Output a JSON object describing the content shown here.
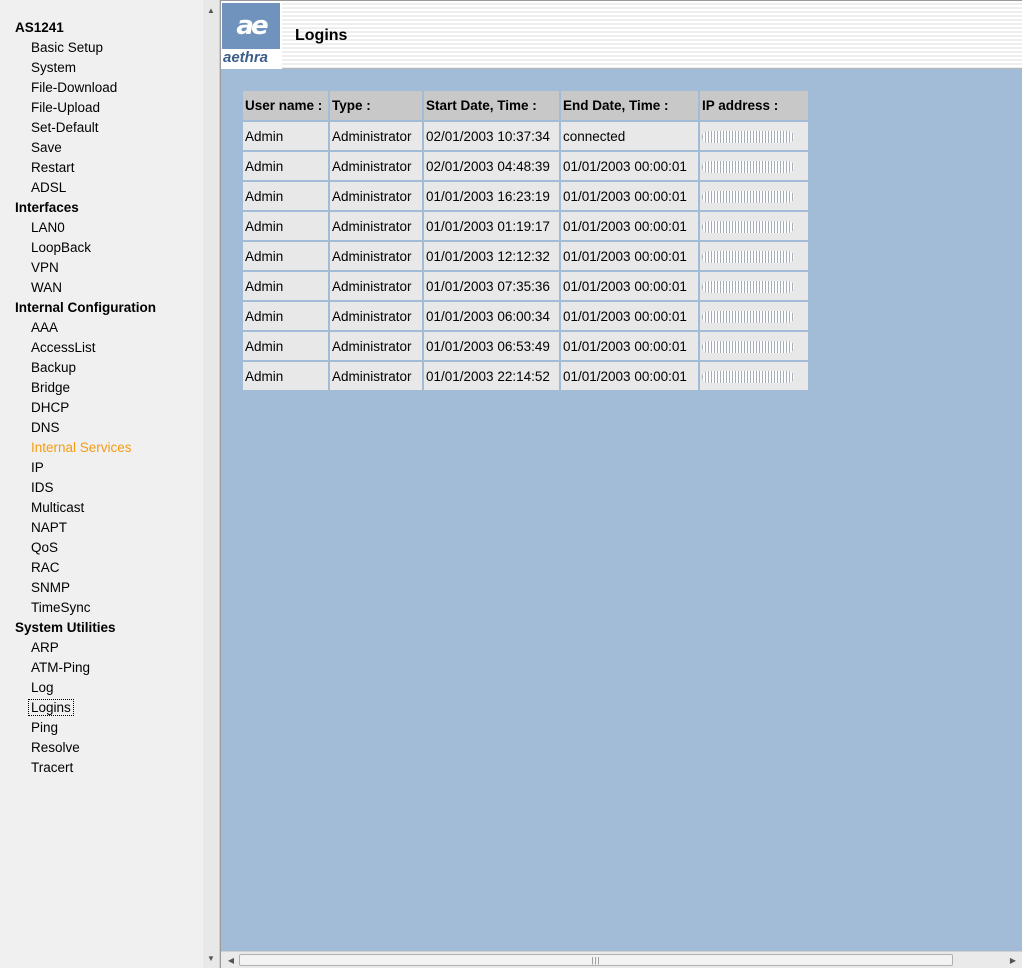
{
  "nav": {
    "sections": [
      {
        "title": "AS1241",
        "items": [
          "Basic Setup",
          "System",
          "File-Download",
          "File-Upload",
          "Set-Default",
          "Save",
          "Restart",
          "ADSL"
        ]
      },
      {
        "title": "Interfaces",
        "items": [
          "LAN0",
          "LoopBack",
          "VPN",
          "WAN"
        ]
      },
      {
        "title": "Internal Configuration",
        "items": [
          "AAA",
          "AccessList",
          "Backup",
          "Bridge",
          "DHCP",
          "DNS",
          "Internal Services",
          "IP",
          "IDS",
          "Multicast",
          "NAPT",
          "QoS",
          "RAC",
          "SNMP",
          "TimeSync"
        ]
      },
      {
        "title": "System Utilities",
        "items": [
          "ARP",
          "ATM-Ping",
          "Log",
          "Logins",
          "Ping",
          "Resolve",
          "Tracert"
        ]
      }
    ],
    "active_item": "Internal Services",
    "focused_item": "Logins",
    "active_color": "#f39c12"
  },
  "header": {
    "logo_mark": "ae",
    "logo_text": "aethra",
    "title": "Logins"
  },
  "table": {
    "headers": [
      "User name :",
      "Type :",
      "Start Date, Time :",
      "End Date, Time :",
      "IP address :"
    ],
    "rows": [
      [
        "Admin",
        "Administrator",
        "02/01/2003 10:37:34",
        "connected"
      ],
      [
        "Admin",
        "Administrator",
        "02/01/2003 04:48:39",
        "01/01/2003 00:00:01"
      ],
      [
        "Admin",
        "Administrator",
        "01/01/2003 16:23:19",
        "01/01/2003 00:00:01"
      ],
      [
        "Admin",
        "Administrator",
        "01/01/2003 01:19:17",
        "01/01/2003 00:00:01"
      ],
      [
        "Admin",
        "Administrator",
        "01/01/2003 12:12:32",
        "01/01/2003 00:00:01"
      ],
      [
        "Admin",
        "Administrator",
        "01/01/2003 07:35:36",
        "01/01/2003 00:00:01"
      ],
      [
        "Admin",
        "Administrator",
        "01/01/2003 06:00:34",
        "01/01/2003 00:00:01"
      ],
      [
        "Admin",
        "Administrator",
        "01/01/2003 06:53:49",
        "01/01/2003 00:00:01"
      ],
      [
        "Admin",
        "Administrator",
        "01/01/2003 22:14:52",
        "01/01/2003 00:00:01"
      ]
    ]
  },
  "colors": {
    "main_bg": "#a2bbd6",
    "header_cell_bg": "#c8c8c8",
    "cell_bg": "#e8e8e8",
    "logo_bg": "#6f93bd"
  }
}
